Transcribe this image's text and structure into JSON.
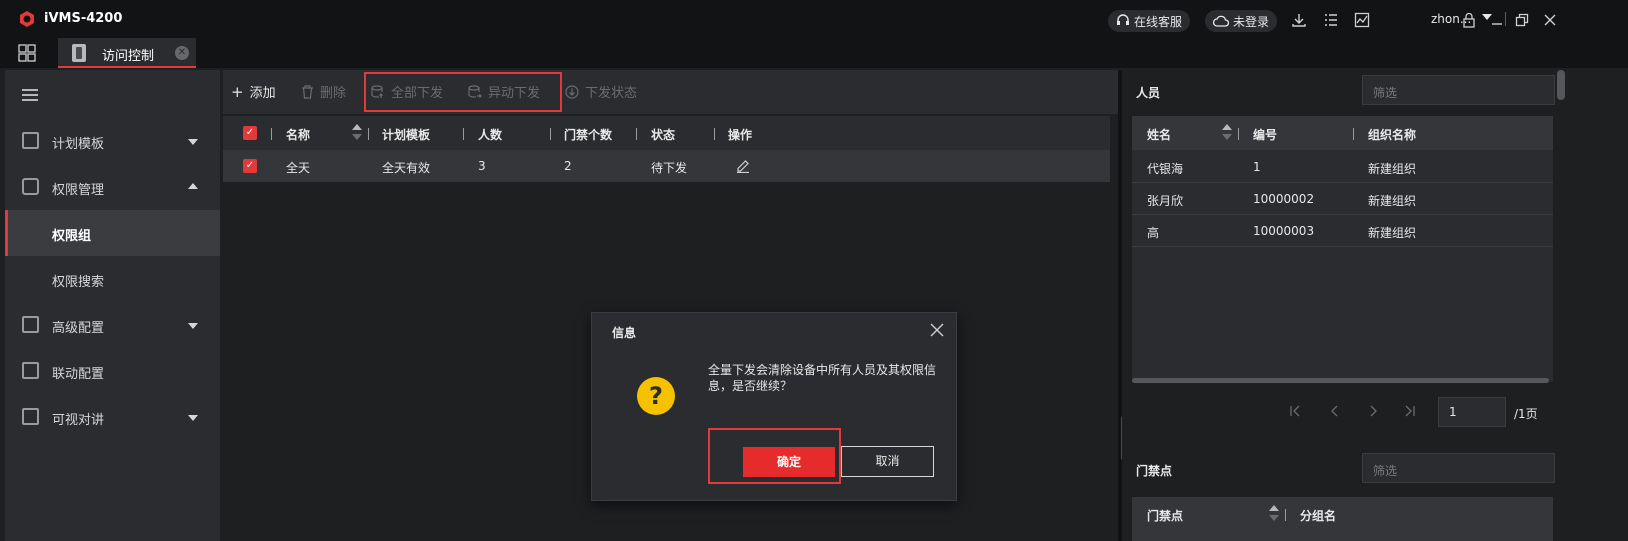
{
  "app": {
    "title": "iVMS-4200",
    "online_service": "在线客服",
    "login": "未登录",
    "user": "zhon...",
    "tab_label": "访问控制",
    "tab_close_glyph": "✕"
  },
  "sidebar": {
    "items": [
      {
        "label": "计划模板",
        "icon": "calendar-edit-icon"
      },
      {
        "label": "权限管理",
        "icon": "lock-icon"
      },
      {
        "label": "权限组"
      },
      {
        "label": "权限搜索"
      },
      {
        "label": "高级配置",
        "icon": "advanced-config-icon"
      },
      {
        "label": "联动配置",
        "icon": "linkage-icon"
      },
      {
        "label": "可视对讲",
        "icon": "intercom-icon"
      }
    ]
  },
  "toolbar": {
    "add": "添加",
    "delete": "删除",
    "apply_all": "全部下发",
    "apply_changed": "异动下发",
    "apply_status": "下发状态"
  },
  "table": {
    "columns": [
      "名称",
      "计划模板",
      "人数",
      "门禁个数",
      "状态",
      "操作"
    ],
    "rows": [
      {
        "name": "全天",
        "template": "全天有效",
        "people": "3",
        "doors": "2",
        "status": "待下发"
      }
    ]
  },
  "right_panel": {
    "people_title": "人员",
    "filter_placeholder": "筛选",
    "people_columns": [
      "姓名",
      "编号",
      "组织名称"
    ],
    "people_rows": [
      {
        "name": "代银海",
        "id": "1",
        "org": "新建组织"
      },
      {
        "name": "张月欣",
        "id": "10000002",
        "org": "新建组织"
      },
      {
        "name": "高",
        "id": "10000003",
        "org": "新建组织"
      }
    ],
    "page_current": "1",
    "page_total": "/1页",
    "doors_title": "门禁点",
    "doors_columns": [
      "门禁点",
      "分组名"
    ]
  },
  "dialog": {
    "title": "信息",
    "message": "全量下发会清除设备中所有人员及其权限信息，是否继续？",
    "icon_glyph": "?",
    "ok": "确定",
    "cancel": "取消"
  },
  "colors": {
    "accent": "#e23a3a",
    "warning": "#f6c200"
  }
}
